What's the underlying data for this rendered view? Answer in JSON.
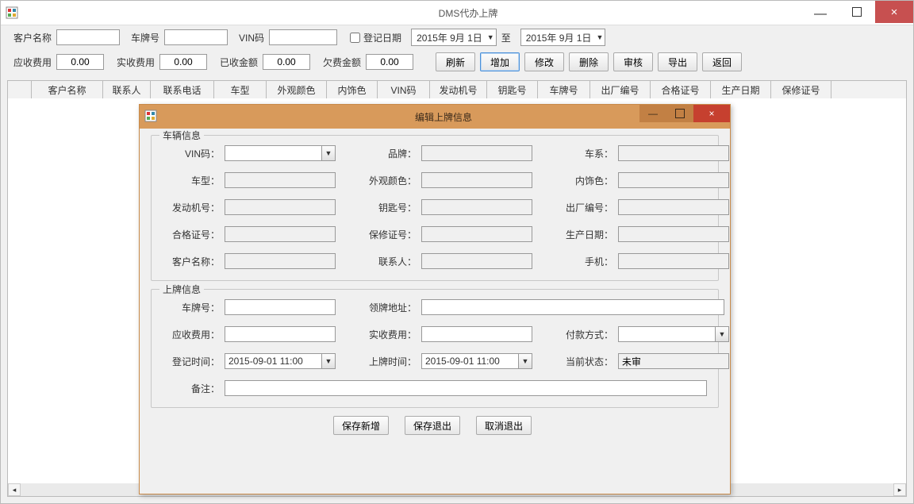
{
  "window": {
    "title": "DMS代办上牌",
    "min": "—",
    "close": "×"
  },
  "search": {
    "customer_label": "客户名称",
    "plate_label": "车牌号",
    "vin_label": "VIN码",
    "regdate_label": "登记日期",
    "to_label": "至",
    "date_from": "2015年 9月 1日",
    "date_to": "2015年 9月 1日"
  },
  "fees": {
    "receivable_label": "应收费用",
    "receivable_value": "0.00",
    "actual_label": "实收费用",
    "actual_value": "0.00",
    "received_label": "已收金额",
    "received_value": "0.00",
    "owed_label": "欠费金额",
    "owed_value": "0.00"
  },
  "toolbar": {
    "refresh": "刷新",
    "add": "增加",
    "edit": "修改",
    "delete": "删除",
    "audit": "审核",
    "export": "导出",
    "back": "返回"
  },
  "grid_headers": [
    "客户名称",
    "联系人",
    "联系电话",
    "车型",
    "外观颜色",
    "内饰色",
    "VIN码",
    "发动机号",
    "钥匙号",
    "车牌号",
    "出厂编号",
    "合格证号",
    "生产日期",
    "保修证号"
  ],
  "dialog": {
    "title": "编辑上牌信息",
    "min": "—",
    "close": "×",
    "vehicle_legend": "车辆信息",
    "registration_legend": "上牌信息",
    "labels": {
      "vin": "VIN码：",
      "brand": "品牌：",
      "series": "车系：",
      "model": "车型：",
      "exterior": "外观颜色：",
      "interior": "内饰色：",
      "engine": "发动机号：",
      "key": "钥匙号：",
      "factory": "出厂编号：",
      "cert": "合格证号：",
      "warranty": "保修证号：",
      "prod_date": "生产日期：",
      "customer": "客户名称：",
      "contact": "联系人：",
      "mobile": "手机：",
      "plate": "车牌号：",
      "pickup_addr": "领牌地址：",
      "receivable": "应收费用：",
      "actual": "实收费用：",
      "pay_method": "付款方式：",
      "reg_time": "登记时间：",
      "plate_time": "上牌时间：",
      "status": "当前状态：",
      "remark": "备注："
    },
    "values": {
      "reg_time": "2015-09-01 11:00",
      "plate_time": "2015-09-01 11:00",
      "status": "未审"
    },
    "buttons": {
      "save_new": "保存新增",
      "save_exit": "保存退出",
      "cancel": "取消退出"
    }
  }
}
